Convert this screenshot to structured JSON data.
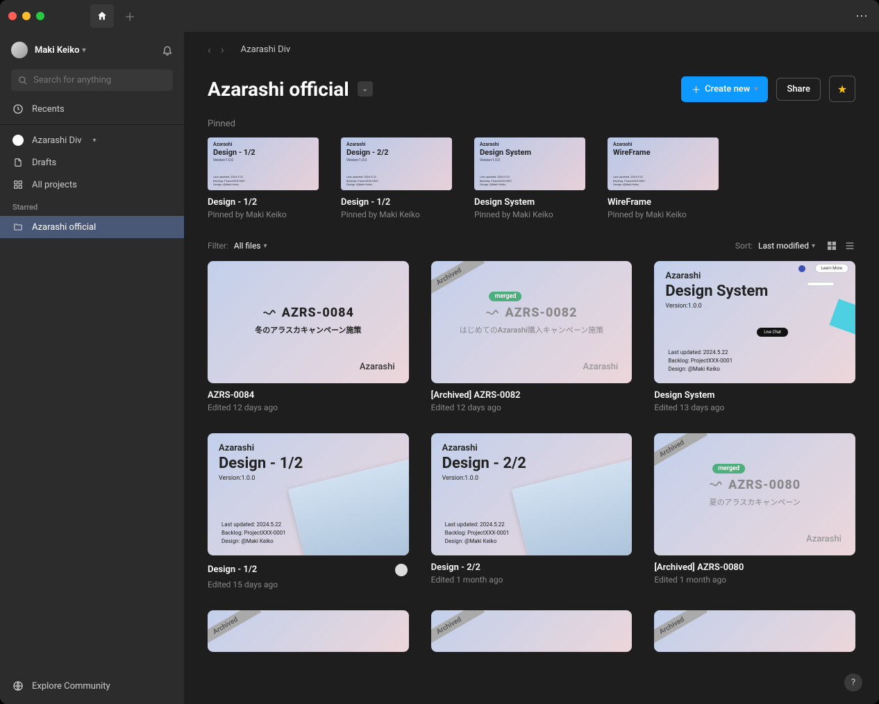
{
  "user": {
    "name": "Maki Keiko"
  },
  "search": {
    "placeholder": "Search for anything"
  },
  "nav": {
    "recents": "Recents",
    "team": "Azarashi Div",
    "drafts": "Drafts",
    "allProjects": "All projects",
    "starredLabel": "Starred",
    "starredItem": "Azarashi official",
    "explore": "Explore Community"
  },
  "breadcrumb": "Azarashi Div",
  "page": {
    "title": "Azarashi official",
    "createNew": "Create new",
    "share": "Share"
  },
  "pinnedLabel": "Pinned",
  "pinned": [
    {
      "title": "Design - 1/2",
      "sub": "Pinned by Maki Keiko",
      "thumbTitle": "Azarashi",
      "thumbSub": "Design - 1/2",
      "thumbVer": "Version:1.0.0"
    },
    {
      "title": "Design - 1/2",
      "sub": "Pinned by Maki Keiko",
      "thumbTitle": "Azarashi",
      "thumbSub": "Design - 2/2",
      "thumbVer": "Version:1.0.0"
    },
    {
      "title": "Design System",
      "sub": "Pinned by Maki Keiko",
      "thumbTitle": "Azarashi",
      "thumbSub": "Design System",
      "thumbVer": "Version:1.0.0"
    },
    {
      "title": "WireFrame",
      "sub": "Pinned by Maki Keiko",
      "thumbTitle": "Azarashi",
      "thumbSub": "WireFrame",
      "thumbVer": ""
    }
  ],
  "filter": {
    "label": "Filter:",
    "value": "All files"
  },
  "sort": {
    "label": "Sort:",
    "value": "Last modified"
  },
  "files": [
    {
      "title": "AZRS-0084",
      "sub": "Edited 12 days ago",
      "type": "ticket",
      "id": "AZRS-0084",
      "desc": "冬のアラスカキャンペーン施策",
      "brand": "Azarashi"
    },
    {
      "title": "[Archived] AZRS-0082",
      "sub": "Edited 12 days ago",
      "type": "ticket-archived",
      "id": "AZRS-0082",
      "desc": "はじめてのAzarashi購入キャンペーン施策",
      "brand": "Azarashi",
      "merged": "merged",
      "archived": "Archived"
    },
    {
      "title": "Design System",
      "sub": "Edited 13 days ago",
      "type": "ds",
      "brand": "Azarashi",
      "heading": "Design System",
      "ver": "Version:1.0.0",
      "meta1": "Last updated: 2024.5.22",
      "meta2": "Backlog: ProjectXXX-0001",
      "meta3": "Design: @Maki Keiko"
    },
    {
      "title": "Design - 1/2",
      "sub": "Edited 15 days ago",
      "type": "design",
      "brand": "Azarashi",
      "heading": "Design - 1/2",
      "ver": "Version:1.0.0",
      "meta1": "Last updated: 2024.5.22",
      "meta2": "Backlog: ProjectXXX-0001",
      "meta3": "Design: @Maki Keiko",
      "avatar": true
    },
    {
      "title": "Design - 2/2",
      "sub": "Edited 1 month ago",
      "type": "design",
      "brand": "Azarashi",
      "heading": "Design - 2/2",
      "ver": "Version:1.0.0",
      "meta1": "Last updated: 2024.5.22",
      "meta2": "Backlog: ProjectXXX-0001",
      "meta3": "Design: @Maki Keiko"
    },
    {
      "title": "[Archived] AZRS-0080",
      "sub": "Edited 1 month ago",
      "type": "ticket-archived",
      "id": "AZRS-0080",
      "desc": "夏のアラスカキャンペーン",
      "brand": "Azarashi",
      "merged": "merged",
      "archived": "Archived"
    },
    {
      "title": "",
      "sub": "",
      "type": "archived-stub",
      "archived": "Archived"
    },
    {
      "title": "",
      "sub": "",
      "type": "archived-stub",
      "archived": "Archived"
    },
    {
      "title": "",
      "sub": "",
      "type": "archived-stub",
      "archived": "Archived"
    }
  ]
}
